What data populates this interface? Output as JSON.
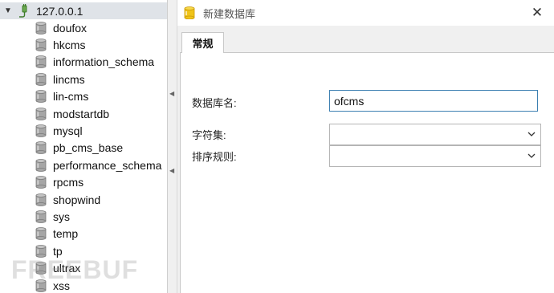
{
  "tree": {
    "connection_label": "127.0.0.1",
    "databases": [
      {
        "label": "doufox"
      },
      {
        "label": "hkcms"
      },
      {
        "label": "information_schema"
      },
      {
        "label": "lincms"
      },
      {
        "label": "lin-cms"
      },
      {
        "label": "modstartdb"
      },
      {
        "label": "mysql"
      },
      {
        "label": "pb_cms_base"
      },
      {
        "label": "performance_schema"
      },
      {
        "label": "rpcms"
      },
      {
        "label": "shopwind"
      },
      {
        "label": "sys"
      },
      {
        "label": "temp"
      },
      {
        "label": "tp"
      },
      {
        "label": "ultrax"
      },
      {
        "label": "xss"
      }
    ]
  },
  "watermark": "FREEBUF",
  "dialog": {
    "title": "新建数据库",
    "close_glyph": "✕",
    "tab_label": "常规",
    "fields": {
      "db_name_label": "数据库名:",
      "db_name_value": "ofcms",
      "charset_label": "字符集:",
      "charset_value": "",
      "collation_label": "排序规则:",
      "collation_value": ""
    }
  },
  "colors": {
    "tree_selected_bg": "#dfe3e8",
    "db_icon": "#9a9a9a",
    "title_icon": "#f0c419",
    "input_focus_border": "#3c7fb1"
  },
  "icons": {
    "connection": "plug-icon",
    "database": "database-cylinder-icon",
    "dialog": "database-cylinder-icon",
    "close": "close-icon",
    "expand": "chevron-down-icon",
    "dropdown": "chevron-down-icon"
  }
}
